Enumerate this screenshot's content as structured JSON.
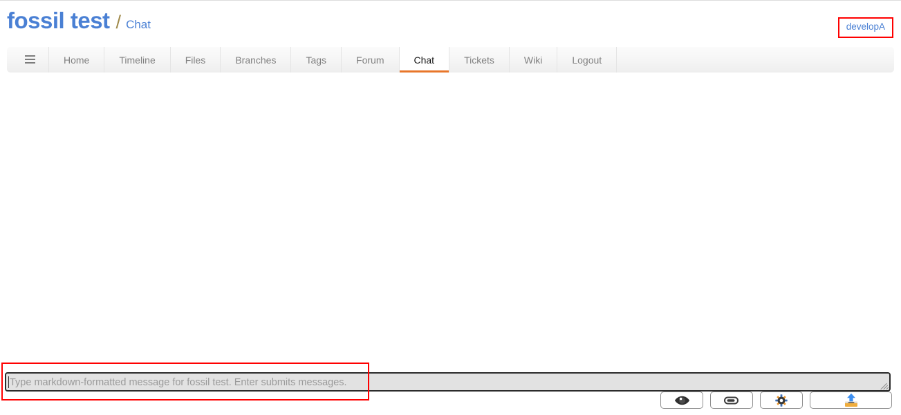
{
  "header": {
    "project_title": "fossil test",
    "separator": "/",
    "page_name": "Chat",
    "user": {
      "label": "developA",
      "highlight_color": "#ff0000"
    }
  },
  "nav": {
    "menu_icon": "hamburger-icon",
    "active_item": "Chat",
    "accent_color": "#e8762a",
    "items": [
      {
        "label": "Home"
      },
      {
        "label": "Timeline"
      },
      {
        "label": "Files"
      },
      {
        "label": "Branches"
      },
      {
        "label": "Tags"
      },
      {
        "label": "Forum"
      },
      {
        "label": "Chat"
      },
      {
        "label": "Tickets"
      },
      {
        "label": "Wiki"
      },
      {
        "label": "Logout"
      }
    ]
  },
  "chat": {
    "messages": [],
    "input": {
      "value": "",
      "placeholder": "Type markdown-formatted message for fossil test. Enter submits messages.",
      "highlight_color": "#ff0000"
    },
    "buttons": [
      {
        "name": "preview-button",
        "icon": "eye-icon"
      },
      {
        "name": "attach-button",
        "icon": "paperclip-icon"
      },
      {
        "name": "settings-button",
        "icon": "gear-icon"
      },
      {
        "name": "file-upload-button",
        "icon": "upload-icon"
      }
    ]
  },
  "colors": {
    "link_blue": "#4a80d4",
    "accent_orange": "#e8762a",
    "annotation_red": "#ff0000"
  }
}
